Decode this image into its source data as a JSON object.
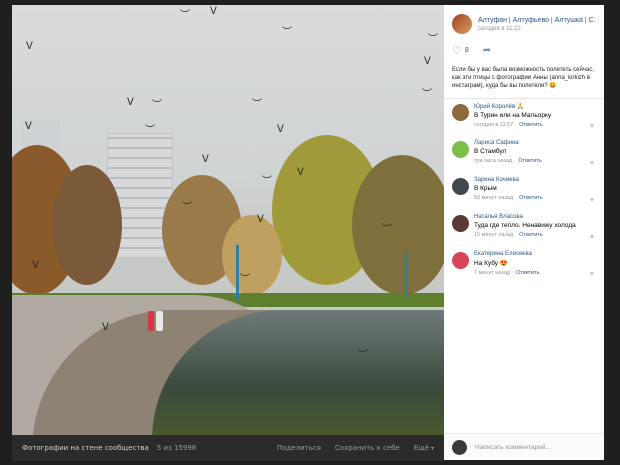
{
  "post": {
    "group_name": "Алтуфан | Алтуфьево | Алтушка | С...",
    "time": "сегодня в 11:22",
    "likes": "8",
    "caption": "Если бы у вас была возможность полететь сейчас, как эти птицы с фотографии Анны (anna_kirkizh в инстаграм), куда бы вы полетели? 😃"
  },
  "comments": [
    {
      "name": "Юрий Королёв 🙏",
      "text": "В Турин или на Мальорку",
      "time": "сегодня в 11:57",
      "reply": "Ответить",
      "avatar_color": "#8d6a3c"
    },
    {
      "name": "Лариса Сафина",
      "text": "В Стамбул",
      "time": "три часа назад",
      "reply": "Ответить",
      "avatar_color": "#7bbf4a"
    },
    {
      "name": "Зарина Кочиева",
      "text": "В Крым",
      "time": "50 минут назад",
      "reply": "Ответить",
      "avatar_color": "#43474d"
    },
    {
      "name": "Наталья Власова",
      "text": "Туда где тепло. Ненавижу холода",
      "time": "15 минут назад",
      "reply": "Ответить",
      "avatar_color": "#5a3b33"
    },
    {
      "name": "Екатерина Елисеева",
      "text": "На Кубу 😍",
      "time": "7 минут назад",
      "reply": "Ответить",
      "avatar_color": "#d8465a"
    }
  ],
  "input": {
    "placeholder": "Написать комментарий..."
  },
  "photo_bar": {
    "title": "Фотографии на стене сообщества",
    "counter": "5 из 15998",
    "share": "Поделиться",
    "save": "Сохранить к себе",
    "more": "Ещё"
  }
}
